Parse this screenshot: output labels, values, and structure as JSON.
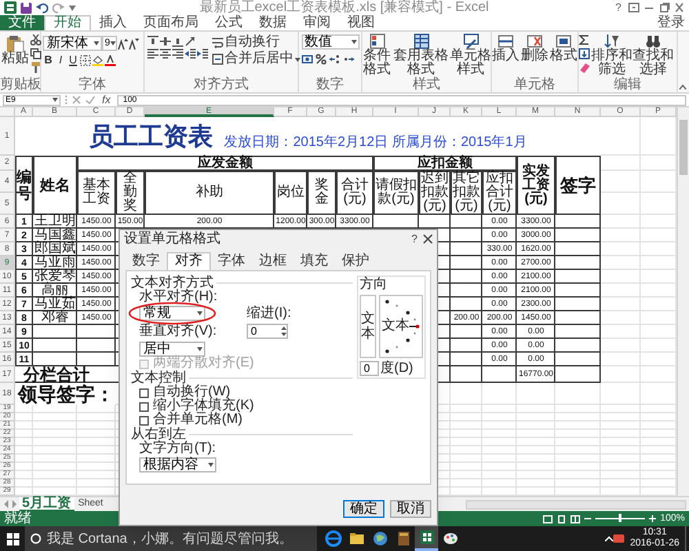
{
  "window": {
    "title": "最新员工excel工资表模板.xls [兼容模式] - Excel",
    "help": "?"
  },
  "ribbon": {
    "tabs": [
      {
        "label": "文件",
        "kind": "file",
        "selected": false
      },
      {
        "label": "开始",
        "kind": "tab",
        "selected": true
      },
      {
        "label": "插入",
        "kind": "tab",
        "selected": false
      },
      {
        "label": "页面布局",
        "kind": "tab",
        "selected": false
      },
      {
        "label": "公式",
        "kind": "tab",
        "selected": false
      },
      {
        "label": "数据",
        "kind": "tab",
        "selected": false
      },
      {
        "label": "审阅",
        "kind": "tab",
        "selected": false
      },
      {
        "label": "视图",
        "kind": "tab",
        "selected": false
      }
    ],
    "sign_in": "登录",
    "clipboard": {
      "paste": "粘贴",
      "label": "剪贴板"
    },
    "font": {
      "name": "新宋体",
      "size": "9",
      "bold": "B",
      "italic": "I",
      "underline": "U",
      "label": "字体"
    },
    "alignment": {
      "wrap_text": "自动换行",
      "merge": "合并后居中",
      "label": "对齐方式"
    },
    "number": {
      "format": "数值",
      "label": "数字"
    },
    "styles": {
      "buttons": [
        "条件格式",
        "套用表格格式",
        "单元格样式"
      ],
      "label": "样式"
    },
    "cells": {
      "buttons": [
        "插入",
        "删除",
        "格式"
      ],
      "label": "单元格"
    },
    "editing": {
      "buttons": [
        "排序和筛选",
        "查找和选择"
      ],
      "label": "编辑"
    }
  },
  "formula_bar": {
    "name_box": "E9",
    "function_label": "fx",
    "formula": "100"
  },
  "columns": [
    {
      "label": "A",
      "selected": false
    },
    {
      "label": "B",
      "selected": false
    },
    {
      "label": "C",
      "selected": false
    },
    {
      "label": "D",
      "selected": false
    },
    {
      "label": "E",
      "selected": true
    },
    {
      "label": "F",
      "selected": false
    },
    {
      "label": "G",
      "selected": false
    },
    {
      "label": "H",
      "selected": false
    },
    {
      "label": "I",
      "selected": false
    },
    {
      "label": "J",
      "selected": false
    },
    {
      "label": "K",
      "selected": false
    },
    {
      "label": "L",
      "selected": false
    },
    {
      "label": "M",
      "selected": false
    },
    {
      "label": "N",
      "selected": false
    },
    {
      "label": "O",
      "selected": false
    },
    {
      "label": "P",
      "selected": false
    }
  ],
  "row_headers": [
    {
      "label": "1",
      "selected": false
    },
    {
      "label": "2",
      "selected": false
    },
    {
      "label": "4",
      "selected": false
    },
    {
      "label": "5",
      "selected": false
    },
    {
      "label": "6",
      "selected": false
    },
    {
      "label": "7",
      "selected": false
    },
    {
      "label": "8",
      "selected": false
    },
    {
      "label": "9",
      "selected": true
    },
    {
      "label": "10",
      "selected": false
    },
    {
      "label": "11",
      "selected": false
    },
    {
      "label": "12",
      "selected": false
    },
    {
      "label": "13",
      "selected": false
    },
    {
      "label": "14",
      "selected": false
    },
    {
      "label": "15",
      "selected": false
    },
    {
      "label": "16",
      "selected": false
    },
    {
      "label": "17",
      "selected": false
    },
    {
      "label": "18",
      "selected": false
    },
    {
      "label": "19",
      "selected": false
    },
    {
      "label": "20",
      "selected": false
    },
    {
      "label": "21",
      "selected": false
    },
    {
      "label": "22",
      "selected": false
    },
    {
      "label": "23",
      "selected": false
    },
    {
      "label": "24",
      "selected": false
    },
    {
      "label": "25",
      "selected": false
    },
    {
      "label": "26",
      "selected": false
    },
    {
      "label": "27",
      "selected": false
    },
    {
      "label": "28",
      "selected": false
    },
    {
      "label": "29",
      "selected": false
    }
  ],
  "sheet": {
    "title": "员工工资表",
    "subtitle": "发放日期：2015年2月12日 所属月份：2015年1月",
    "headers": {
      "number": "编号",
      "name": "姓名",
      "payable": "应发金额",
      "payable_columns": [
        "基本工资",
        "全勤奖",
        "补助",
        "岗位",
        "奖金",
        "合计(元)"
      ],
      "deduction": "应扣金额",
      "deduction_columns": [
        "请假扣款(元)",
        "迟到扣款(元)",
        "其它扣款(元)",
        "应扣合计(元)"
      ],
      "net_pay": "实发工资(元)",
      "signature": "签字"
    },
    "rows": [
      {
        "no": "1",
        "name": "王卫明",
        "base_pay": "1450.00",
        "full_attendance": "150.00",
        "allowance": "200.00",
        "post": "1200.00",
        "bonus": "300.00",
        "gross_total": "3300.00",
        "deduction_total": "0.00",
        "net_pay": "3300.00"
      },
      {
        "no": "2",
        "name": "马国鑫",
        "base_pay": "1450.00",
        "deduction_total": "0.00",
        "net_pay": "3000.00"
      },
      {
        "no": "3",
        "name": "郎国斌",
        "base_pay": "1450.00",
        "deduction_total": "330.00",
        "net_pay": "1620.00"
      },
      {
        "no": "4",
        "name": "马亚雨",
        "base_pay": "1450.00",
        "deduction_total": "0.00",
        "net_pay": "2700.00"
      },
      {
        "no": "5",
        "name": "张爱琴",
        "base_pay": "1450.00",
        "deduction_total": "0.00",
        "net_pay": "2100.00"
      },
      {
        "no": "6",
        "name": "高丽",
        "base_pay": "1450.00",
        "deduction_total": "0.00",
        "net_pay": "2100.00"
      },
      {
        "no": "7",
        "name": "马亚茹",
        "base_pay": "1450.00",
        "deduction_total": "0.00",
        "net_pay": "2300.00"
      },
      {
        "no": "8",
        "name": "邓睿",
        "base_pay": "1450.00",
        "other_deduction": "200.00",
        "deduction_total": "200.00",
        "net_pay": "1450.00"
      },
      {
        "no": "9",
        "deduction_total": "0.00",
        "net_pay": "0.00"
      },
      {
        "no": "10",
        "deduction_total": "0.00",
        "net_pay": "0.00"
      },
      {
        "no": "11",
        "deduction_total": "0.00",
        "net_pay": "0.00"
      }
    ],
    "subtotal": {
      "label": "分栏合计",
      "net_pay": "16770.00"
    },
    "leader_sign": "领导签字："
  },
  "dialog": {
    "title": "设置单元格格式",
    "help": "?",
    "tabs": [
      {
        "label": "数字",
        "selected": false
      },
      {
        "label": "对齐",
        "selected": true
      },
      {
        "label": "字体",
        "selected": false
      },
      {
        "label": "边框",
        "selected": false
      },
      {
        "label": "填充",
        "selected": false
      },
      {
        "label": "保护",
        "selected": false
      }
    ],
    "text_alignment": "文本对齐方式",
    "horizontal_align": {
      "label": "水平对齐(H):",
      "value": "常规",
      "highlighted": true
    },
    "indent": {
      "label": "缩进(I):",
      "value": "0"
    },
    "vertical_align": {
      "label": "垂直对齐(V):",
      "value": "居中"
    },
    "distributed": {
      "label": "两端分散对齐(E)",
      "checked": false,
      "disabled": true
    },
    "text_control": "文本控制",
    "text_control_options": [
      {
        "label": "自动换行(W)",
        "checked": false
      },
      {
        "label": "缩小字体填充(K)",
        "checked": false
      },
      {
        "label": "合并单元格(M)",
        "checked": false
      }
    ],
    "rtl": "从右到左",
    "text_direction": {
      "label": "文字方向(T):",
      "value": "根据内容"
    },
    "orientation": {
      "label": "方向",
      "vertical_text": "文本",
      "dial_text": "文本",
      "degrees": "0",
      "degrees_label": "度(D)"
    },
    "buttons": [
      "确定",
      "取消"
    ]
  },
  "sheet_tabs": [
    {
      "label": "5月工资",
      "selected": true
    },
    {
      "label": "Sheet",
      "selected": false
    }
  ],
  "status_bar": {
    "status": "就绪",
    "zoom": {
      "level": 0.5,
      "reading": "100%"
    }
  },
  "taskbar": {
    "search_placeholder": "我是 Cortana，小娜。有问题尽管问我。",
    "apps": [
      {
        "selected": false
      },
      {
        "selected": false
      },
      {
        "selected": false
      },
      {
        "selected": false
      },
      {
        "selected": true
      },
      {
        "selected": false
      }
    ],
    "time": "10:31",
    "date": "2016-01-26"
  }
}
